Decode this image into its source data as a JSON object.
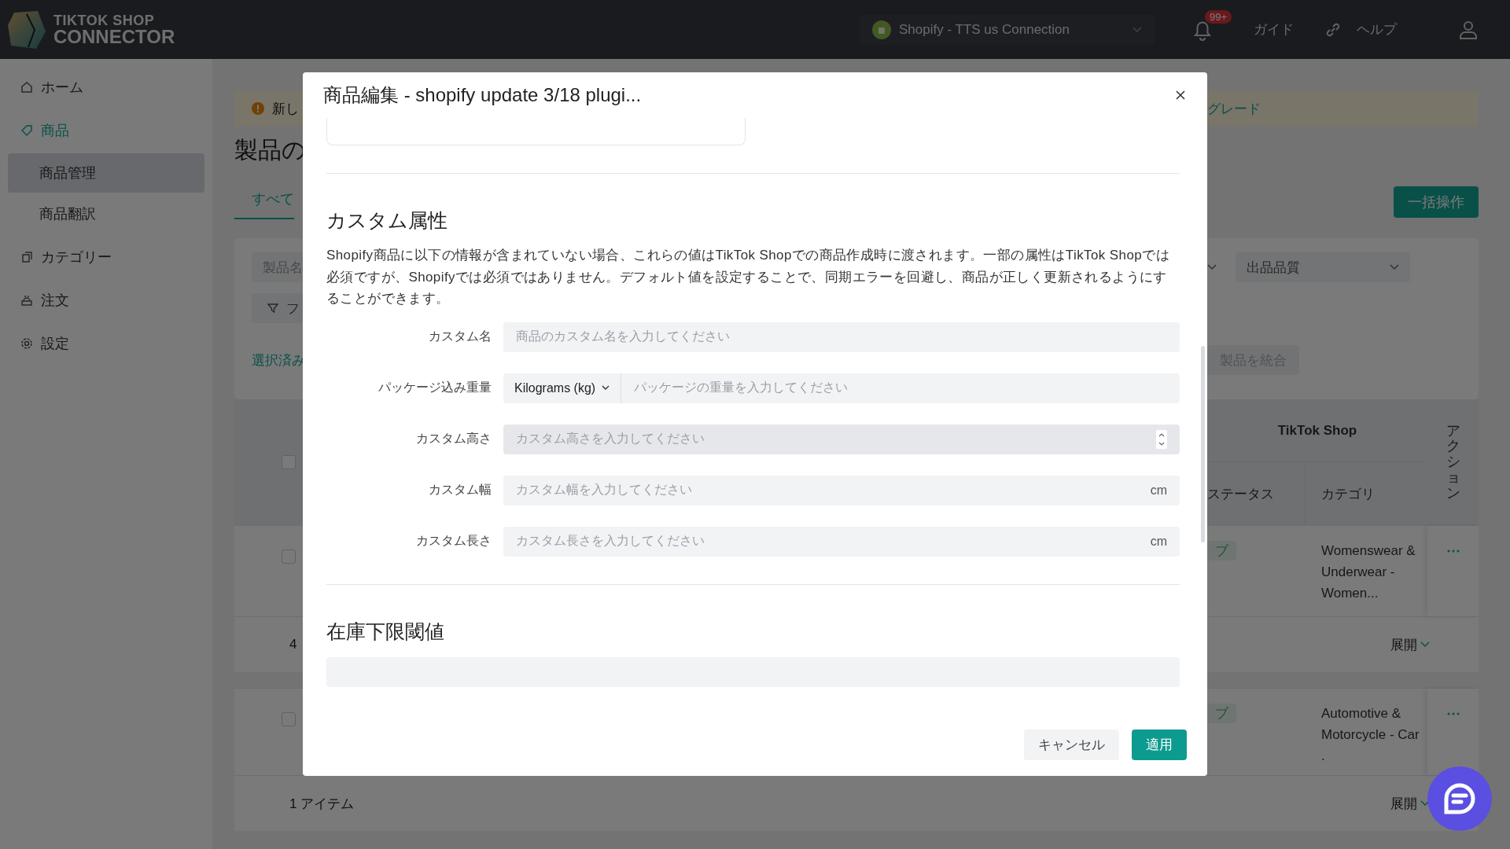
{
  "top_bar": {
    "logo_line1": "TIKTOK SHOP",
    "logo_line2": "CONNECTOR",
    "connection": "Shopify - TTS us Connection",
    "notification_badge": "99+",
    "guide": "ガイド",
    "help": "ヘルプ"
  },
  "sidebar": {
    "items": [
      {
        "label": "ホーム",
        "selected": false
      },
      {
        "label": "商品",
        "selected": true,
        "children": [
          {
            "label": "商品管理",
            "selected": true
          },
          {
            "label": "商品翻訳",
            "selected": false
          }
        ]
      },
      {
        "label": "カテゴリー",
        "selected": false
      },
      {
        "label": "注文",
        "selected": false
      },
      {
        "label": "設定",
        "selected": false
      }
    ]
  },
  "page": {
    "banner_left": "新し",
    "banner_right": "グレード",
    "title": "製品の",
    "bulk_button": "一括操作",
    "tabs": [
      {
        "label": "すべて",
        "selected": true
      }
    ],
    "filters": {
      "search_placeholder": "製品名",
      "filter_button": "フ",
      "quality_select": "出品品質",
      "selected_link": "選択済み",
      "merge_button": "製品を統合",
      "merge_disabled": true
    },
    "table": {
      "group_header": "TikTok Shop",
      "columns": [
        "ステータス",
        "カテゴリ"
      ],
      "action_header": "アクション",
      "header_checked": false,
      "rows": [
        {
          "checked": false,
          "status": "ブ",
          "category": "Womenswear & Underwear - Women...",
          "summary": "4",
          "expand": "展開"
        },
        {
          "checked": false,
          "status": "ブ",
          "category": "Automotive & Motorcycle - Car .",
          "summary": "1 アイテム",
          "expand": "展開"
        }
      ]
    }
  },
  "modal": {
    "title": "商品編集 - shopify update 3/18 plugi...",
    "sections": [
      {
        "heading": "カスタム属性",
        "description": "Shopify商品に以下の情報が含まれていない場合、これらの値はTikTok Shopでの商品作成時に渡されます。一部の属性はTikTok Shopでは必須ですが、Shopifyでは必須ではありません。デフォルト値を設定することで、同期エラーを回避し、商品が正しく更新されるようにすることができます。",
        "fields": [
          {
            "kind": "text",
            "label": "カスタム名",
            "placeholder": "商品のカスタム名を入力してください"
          },
          {
            "kind": "unit-select",
            "label": "パッケージ込み重量",
            "unit": "Kilograms (kg)",
            "placeholder": "パッケージの重量を入力してください"
          },
          {
            "kind": "number",
            "label": "カスタム高さ",
            "placeholder": "カスタム高さを入力してください"
          },
          {
            "kind": "suffix",
            "label": "カスタム幅",
            "placeholder": "カスタム幅を入力してください",
            "suffix": "cm"
          },
          {
            "kind": "suffix",
            "label": "カスタム長さ",
            "placeholder": "カスタム長さを入力してください",
            "suffix": "cm"
          }
        ]
      },
      {
        "heading": "在庫下限閾値",
        "fields": [
          {
            "kind": "text"
          }
        ]
      }
    ],
    "buttons": {
      "cancel": "キャンセル",
      "apply": "適用"
    }
  }
}
